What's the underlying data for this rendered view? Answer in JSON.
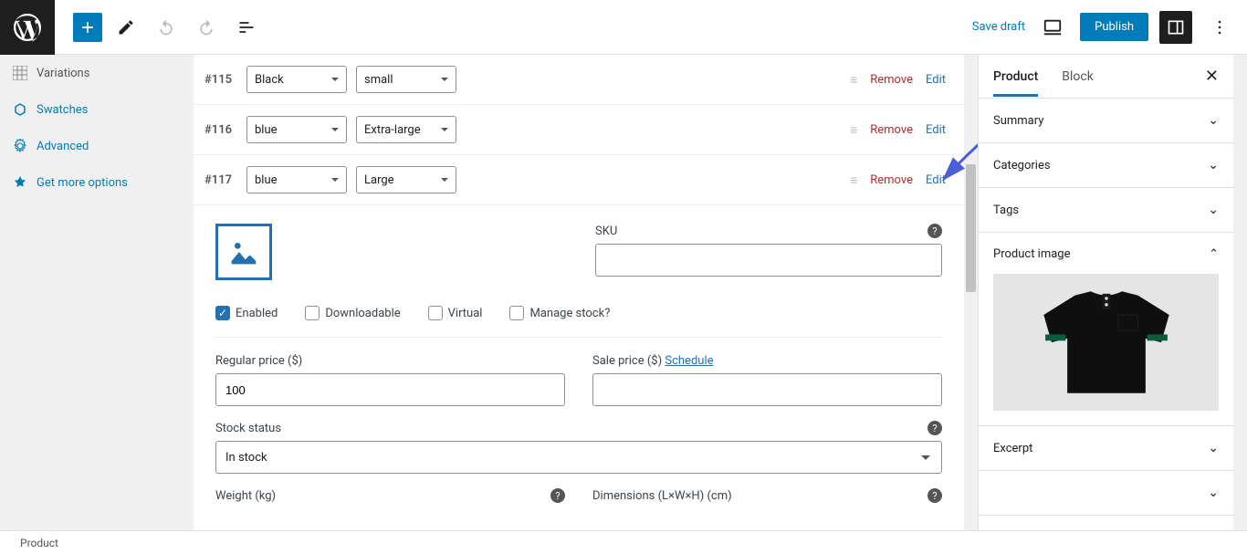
{
  "toolbar": {
    "save_draft": "Save draft",
    "publish": "Publish"
  },
  "left_sidebar": {
    "items": [
      {
        "label": "Variations",
        "blue": false
      },
      {
        "label": "Swatches",
        "blue": true
      },
      {
        "label": "Advanced",
        "blue": true
      },
      {
        "label": "Get more options",
        "blue": true
      }
    ]
  },
  "variations": [
    {
      "id": "#115",
      "attr1": "Black",
      "attr2": "small",
      "remove": "Remove",
      "edit": "Edit"
    },
    {
      "id": "#116",
      "attr1": "blue",
      "attr2": "Extra-large",
      "remove": "Remove",
      "edit": "Edit"
    },
    {
      "id": "#117",
      "attr1": "blue",
      "attr2": "Large",
      "remove": "Remove",
      "edit": "Edit"
    }
  ],
  "panel": {
    "sku_label": "SKU",
    "sku_value": "",
    "enabled_label": "Enabled",
    "enabled_checked": true,
    "downloadable_label": "Downloadable",
    "virtual_label": "Virtual",
    "manage_stock_label": "Manage stock?",
    "regular_price_label": "Regular price ($)",
    "regular_price_value": "100",
    "sale_price_label": "Sale price ($)",
    "schedule_label": "Schedule",
    "sale_price_value": "",
    "stock_status_label": "Stock status",
    "stock_status_value": "In stock",
    "weight_label": "Weight (kg)",
    "dimensions_label": "Dimensions (L×W×H) (cm)"
  },
  "right_sidebar": {
    "tabs": {
      "product": "Product",
      "block": "Block"
    },
    "panels": {
      "summary": "Summary",
      "categories": "Categories",
      "tags": "Tags",
      "product_image": "Product image",
      "excerpt": "Excerpt"
    }
  },
  "footer": {
    "breadcrumb": "Product"
  }
}
